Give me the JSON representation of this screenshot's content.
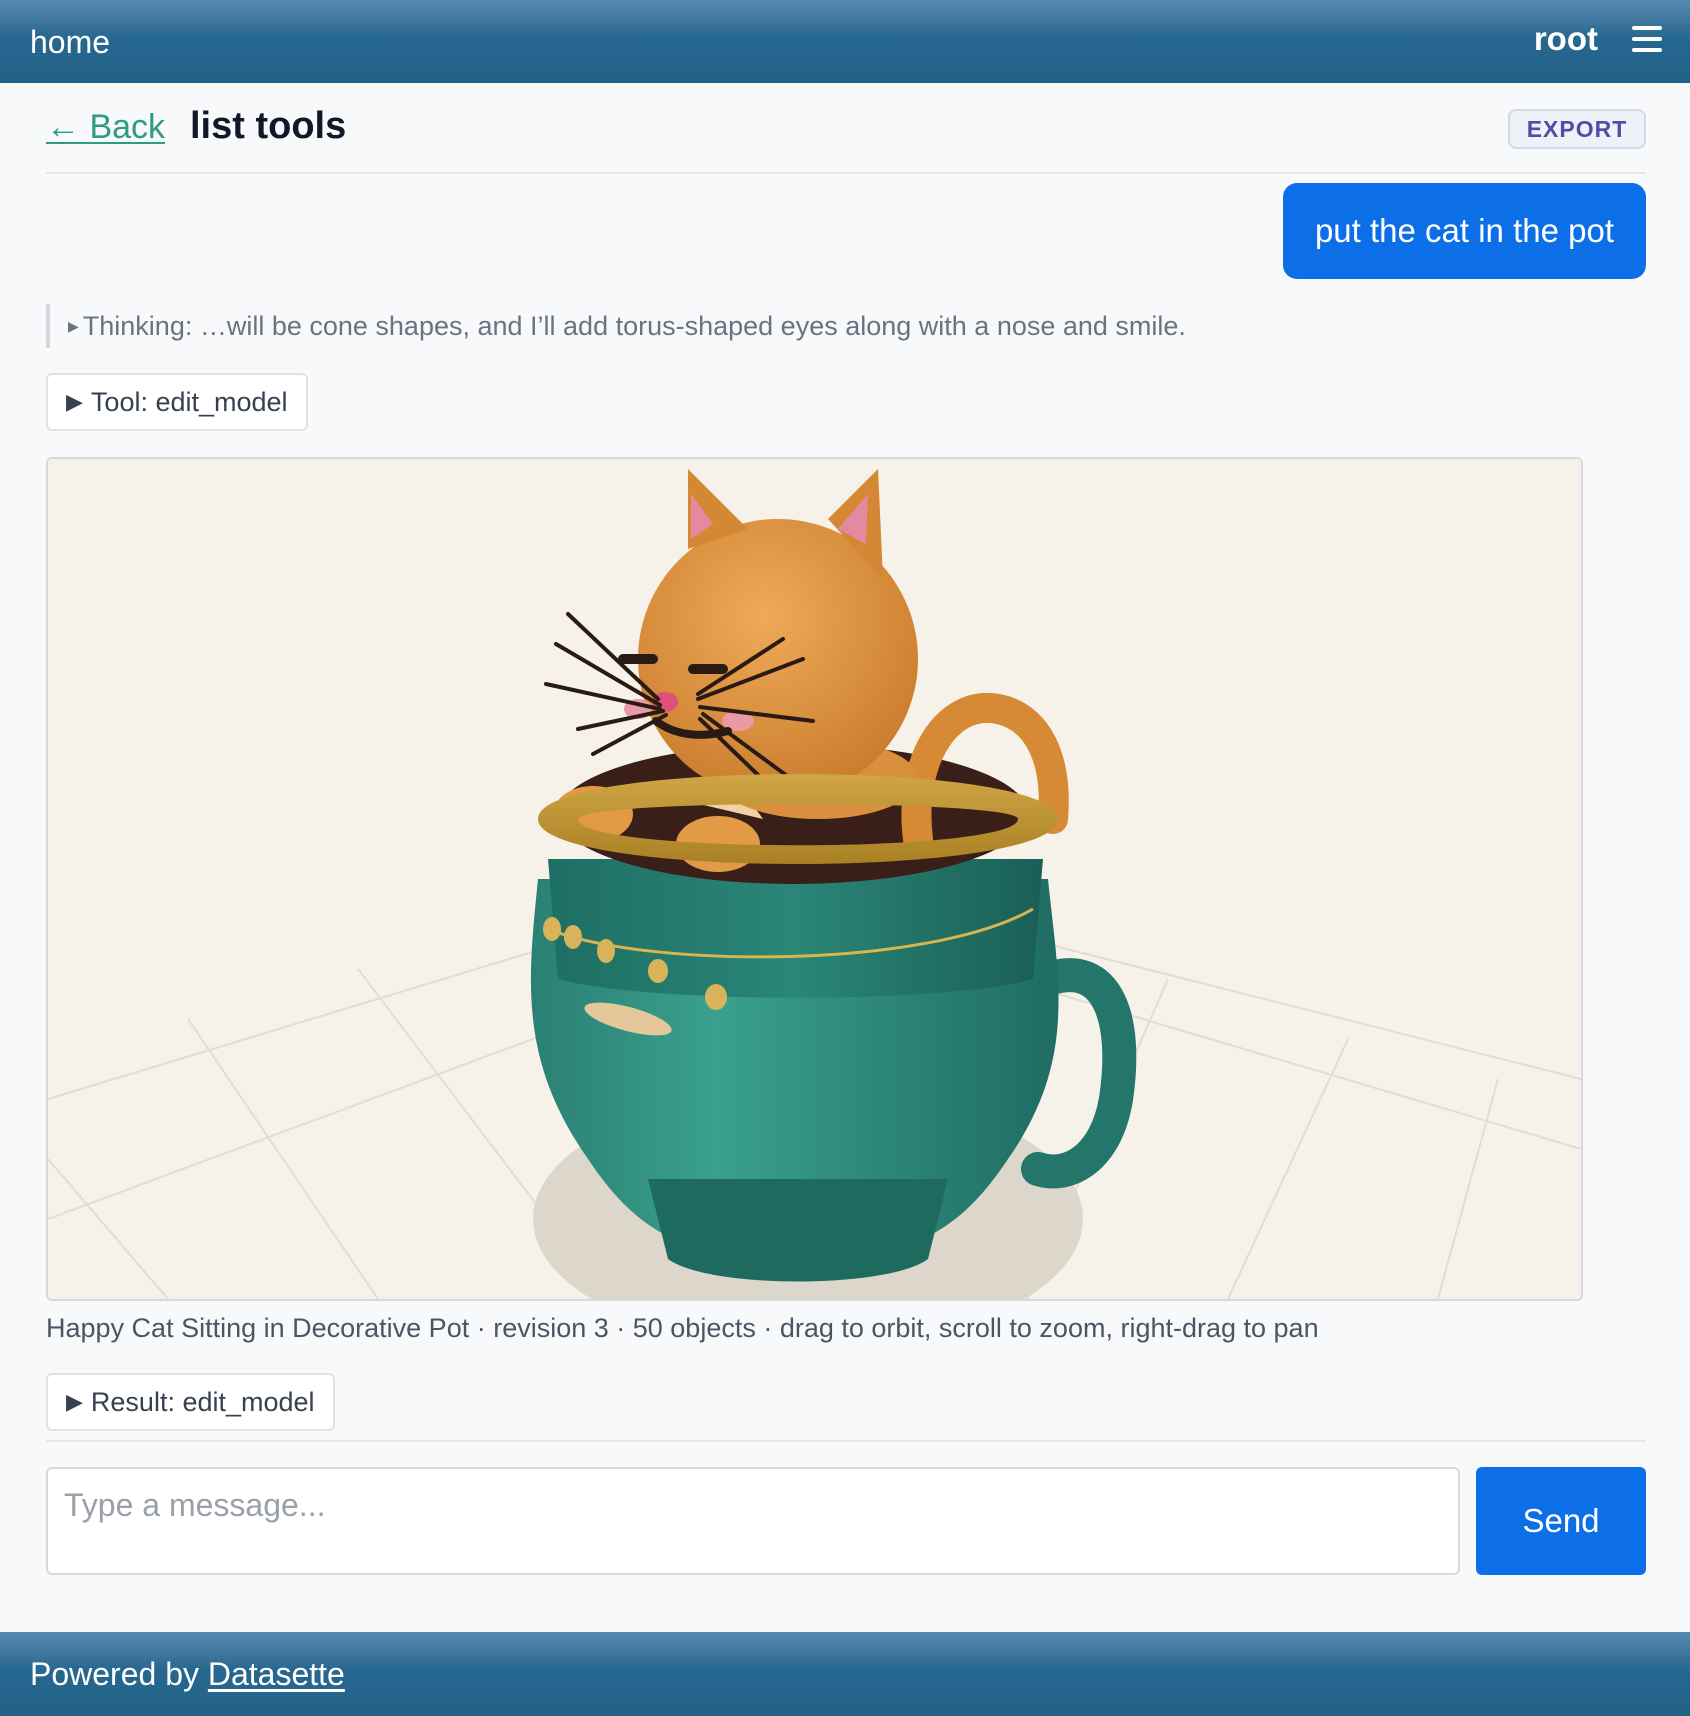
{
  "topbar": {
    "home_label": "home",
    "user_label": "root"
  },
  "page": {
    "back_label": "← Back",
    "title": "list tools",
    "export_label": "EXPORT"
  },
  "conversation": {
    "user_message": "put the cat in the pot",
    "thinking": "Thinking: …will be cone shapes, and I’ll add torus-shaped eyes along with a nose and smile.",
    "tool_toggle": "Tool: edit_model",
    "model_caption": "Happy Cat Sitting in Decorative Pot · revision 3 · 50 objects · drag to orbit, scroll to zoom, right-drag to pan",
    "result_toggle": "Result: edit_model"
  },
  "composer": {
    "placeholder": "Type a message...",
    "send_label": "Send"
  },
  "footer": {
    "prefix": "Powered by ",
    "link_label": "Datasette"
  },
  "icons": {
    "menu": "hamburger-menu-icon",
    "disclosure": "triangle-right-icon"
  },
  "colors": {
    "header_blue": "#276890",
    "primary_button": "#0d6fe8",
    "back_link": "#2f9c7e",
    "viewer_background": "#f6f2ea",
    "pot_teal": "#2f8f80",
    "cat_orange": "#e0953f"
  }
}
